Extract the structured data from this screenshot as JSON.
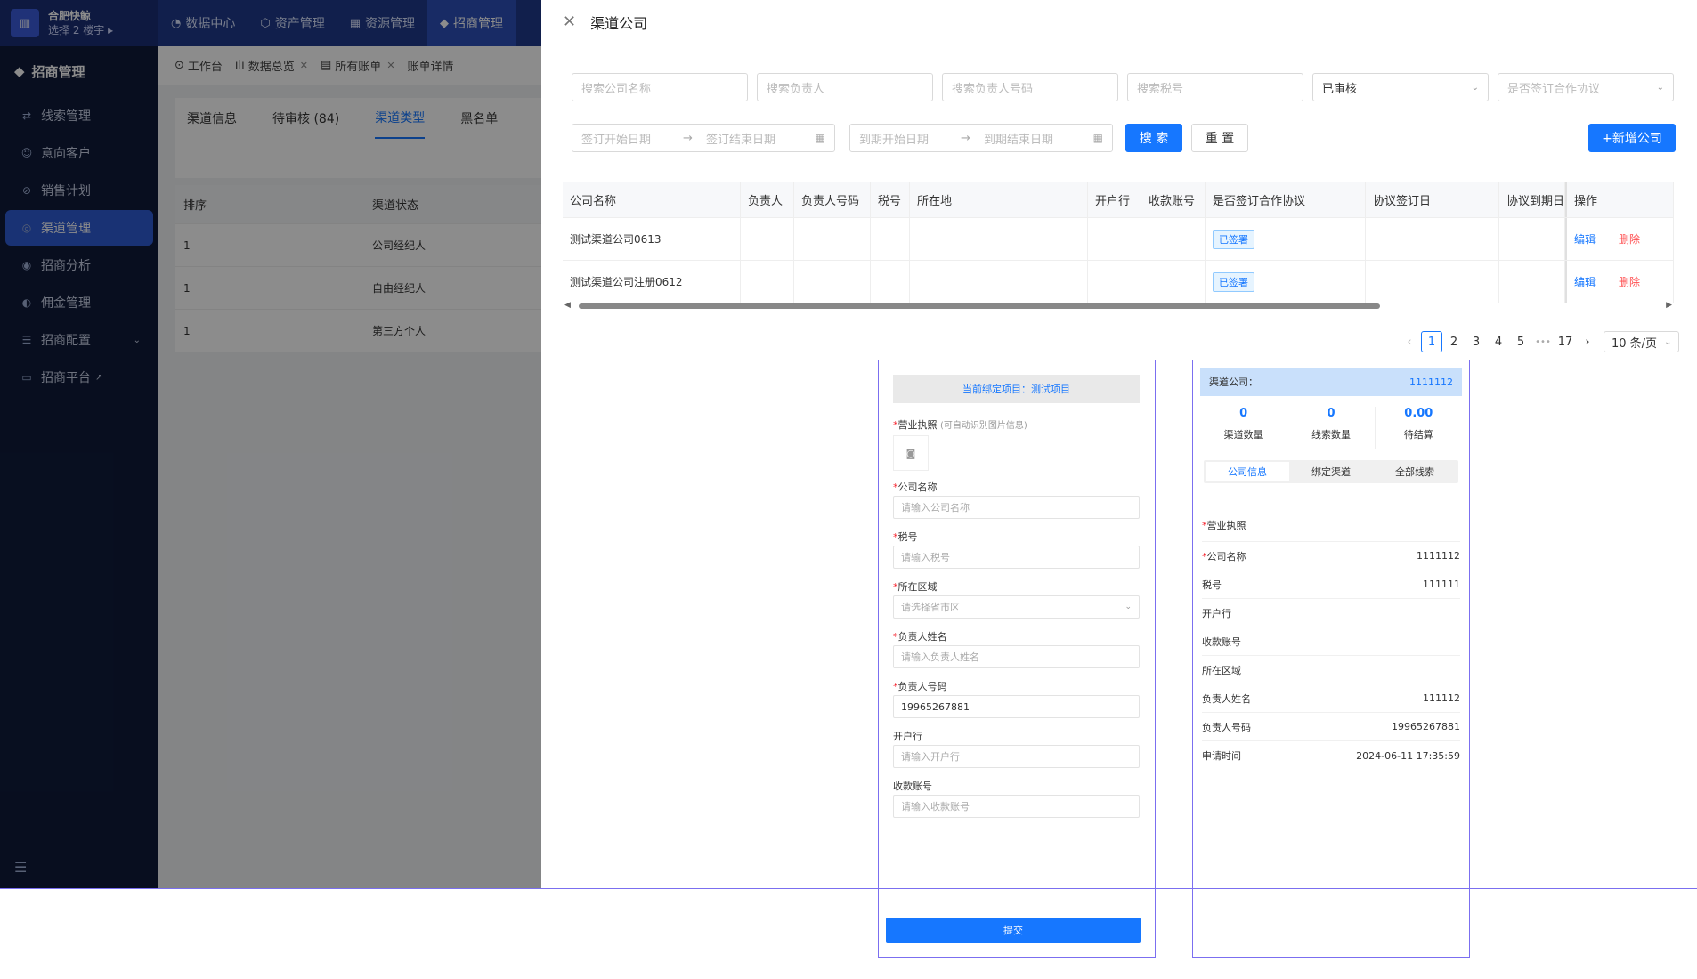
{
  "topbar": {
    "company": "合肥快鲸",
    "building": "选择 2 楼宇 ▸",
    "nav": [
      {
        "label": "数据中心",
        "icon": "pie-icon"
      },
      {
        "label": "资产管理",
        "icon": "cube-icon"
      },
      {
        "label": "资源管理",
        "icon": "building-icon"
      },
      {
        "label": "招商管理",
        "icon": "tag-icon",
        "active": true
      }
    ]
  },
  "sidebar": {
    "title": "招商管理",
    "items": [
      {
        "label": "线索管理",
        "icon": "clue-icon"
      },
      {
        "label": "意向客户",
        "icon": "user-icon"
      },
      {
        "label": "销售计划",
        "icon": "plan-icon"
      },
      {
        "label": "渠道管理",
        "icon": "channel-icon",
        "active": true
      },
      {
        "label": "招商分析",
        "icon": "analysis-icon"
      },
      {
        "label": "佣金管理",
        "icon": "commission-icon"
      },
      {
        "label": "招商配置",
        "icon": "config-icon",
        "expandable": true
      },
      {
        "label": "招商平台",
        "icon": "platform-icon",
        "external": true
      }
    ]
  },
  "bgpage": {
    "tabs": [
      "工作台",
      "数据总览",
      "所有账单",
      "账单详情"
    ],
    "subtabs": [
      "渠道信息",
      "待审核 (84)",
      "渠道类型",
      "黑名单"
    ],
    "table_headers": [
      "排序",
      "渠道状态"
    ],
    "rows": [
      [
        "1",
        "公司经纪人"
      ],
      [
        "1",
        "自由经纪人"
      ],
      [
        "1",
        "第三方个人"
      ]
    ]
  },
  "drawer": {
    "title": "渠道公司",
    "filters": {
      "company_name": "搜索公司名称",
      "person": "搜索负责人",
      "phone": "搜索负责人号码",
      "tax": "搜索税号",
      "audit_status": "已审核",
      "signed": "是否签订合作协议",
      "sign_start": "签订开始日期",
      "sign_end": "签订结束日期",
      "expire_start": "到期开始日期",
      "expire_end": "到期结束日期"
    },
    "buttons": {
      "search": "搜 索",
      "reset": "重 置",
      "add": "+新增公司"
    },
    "table": {
      "headers": [
        "公司名称",
        "负责人",
        "负责人号码",
        "税号",
        "所在地",
        "开户行",
        "收款账号",
        "是否签订合作协议",
        "协议签订日",
        "协议到期日",
        "操作"
      ],
      "rows": [
        {
          "name": "测试渠道公司0613",
          "signed": "已签署",
          "edit": "编辑",
          "delete": "删除"
        },
        {
          "name": "测试渠道公司注册0612",
          "signed": "已签署",
          "edit": "编辑",
          "delete": "删除"
        }
      ]
    },
    "pager": {
      "pages": [
        "1",
        "2",
        "3",
        "4",
        "5",
        "•••",
        "17"
      ],
      "size": "10 条/页"
    }
  },
  "form": {
    "project": "当前绑定项目：测试项目",
    "license_label": "营业执照",
    "license_hint": "(可自动识别图片信息)",
    "fields": [
      {
        "label": "公司名称",
        "req": true,
        "placeholder": "请输入公司名称"
      },
      {
        "label": "税号",
        "req": true,
        "placeholder": "请输入税号"
      },
      {
        "label": "所在区域",
        "req": true,
        "placeholder": "请选择省市区"
      },
      {
        "label": "负责人姓名",
        "req": true,
        "placeholder": "请输入负责人姓名"
      },
      {
        "label": "负责人号码",
        "req": true,
        "value": "19965267881"
      },
      {
        "label": "开户行",
        "req": false,
        "placeholder": "请输入开户行"
      },
      {
        "label": "收款账号",
        "req": false,
        "placeholder": "请输入收款账号"
      }
    ],
    "submit": "提交"
  },
  "detail": {
    "header_label": "渠道公司：",
    "header_value": "1111112",
    "stats": [
      {
        "value": "0",
        "label": "渠道数量"
      },
      {
        "value": "0",
        "label": "线索数量"
      },
      {
        "value": "0.00",
        "label": "待结算"
      }
    ],
    "tabs": [
      "公司信息",
      "绑定渠道",
      "全部线索"
    ],
    "rows": [
      {
        "label": "营业执照",
        "req": true,
        "value": ""
      },
      {
        "label": "公司名称",
        "req": true,
        "value": "1111112"
      },
      {
        "label": "税号",
        "req": false,
        "value": "111111"
      },
      {
        "label": "开户行",
        "req": false,
        "value": ""
      },
      {
        "label": "收款账号",
        "req": false,
        "value": ""
      },
      {
        "label": "所在区域",
        "req": false,
        "value": ""
      },
      {
        "label": "负责人姓名",
        "req": false,
        "value": "111112"
      },
      {
        "label": "负责人号码",
        "req": false,
        "value": "19965267881"
      },
      {
        "label": "申请时间",
        "req": false,
        "value": "2024-06-11 17:35:59"
      }
    ]
  },
  "colors": {
    "primary": "#1677ff",
    "nav": "#1f3a8a",
    "sidebar": "#0f1b3a",
    "danger": "#ff4d4f",
    "outline": "#7b6ff0"
  }
}
